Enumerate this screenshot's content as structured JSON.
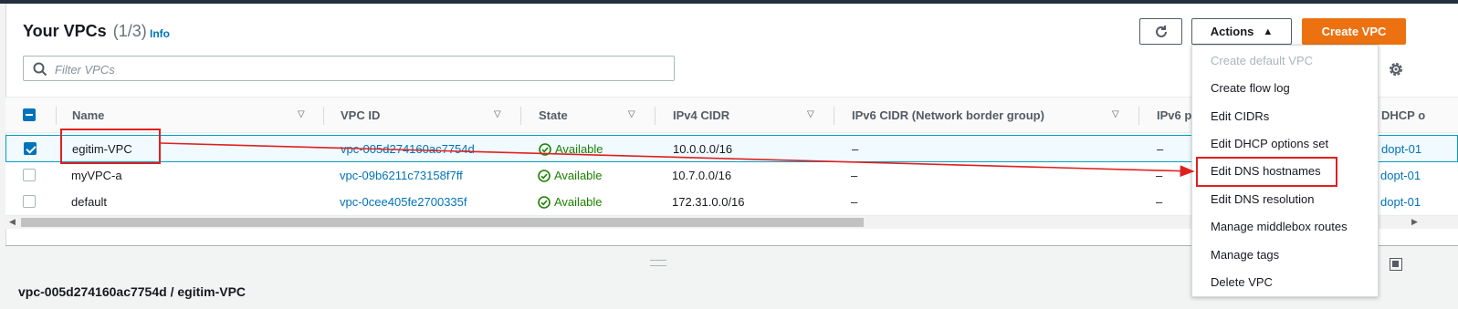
{
  "header": {
    "title": "Your VPCs",
    "count": "(1/3)",
    "info": "Info",
    "refresh_icon": "refresh-icon",
    "actions_label": "Actions",
    "create_label": "Create VPC",
    "settings_icon": "gear-icon"
  },
  "search": {
    "placeholder": "Filter VPCs"
  },
  "table": {
    "columns": [
      "Name",
      "VPC ID",
      "State",
      "IPv4 CIDR",
      "IPv6 CIDR (Network border group)",
      "IPv6 p",
      "DHCP o"
    ],
    "rows": [
      {
        "name": "egitim-VPC",
        "vpc_id": "vpc-005d274160ac7754d",
        "state": "Available",
        "ipv4": "10.0.0.0/16",
        "ipv6": "–",
        "ipv6p": "–",
        "dhcp": "dopt-01",
        "selected": true
      },
      {
        "name": "myVPC-a",
        "vpc_id": "vpc-09b6211c73158f7ff",
        "state": "Available",
        "ipv4": "10.7.0.0/16",
        "ipv6": "–",
        "ipv6p": "–",
        "dhcp": "dopt-01",
        "selected": false
      },
      {
        "name": "default",
        "vpc_id": "vpc-0cee405fe2700335f",
        "state": "Available",
        "ipv4": "172.31.0.0/16",
        "ipv6": "–",
        "ipv6p": "–",
        "dhcp": "dopt-01",
        "selected": false
      }
    ]
  },
  "actions_menu": {
    "items": [
      {
        "label": "Create default VPC",
        "disabled": true
      },
      {
        "label": "Create flow log",
        "disabled": false
      },
      {
        "label": "Edit CIDRs",
        "disabled": false
      },
      {
        "label": "Edit DHCP options set",
        "disabled": false
      },
      {
        "label": "Edit DNS hostnames",
        "disabled": false
      },
      {
        "label": "Edit DNS resolution",
        "disabled": false
      },
      {
        "label": "Manage middlebox routes",
        "disabled": false
      },
      {
        "label": "Manage tags",
        "disabled": false
      },
      {
        "label": "Delete VPC",
        "disabled": false
      }
    ]
  },
  "details": {
    "title": "vpc-005d274160ac7754d / egitim-VPC"
  },
  "colors": {
    "accent": "#0073bb",
    "primary": "#ec7211",
    "available": "#1d8102",
    "annotation": "#e02020"
  }
}
